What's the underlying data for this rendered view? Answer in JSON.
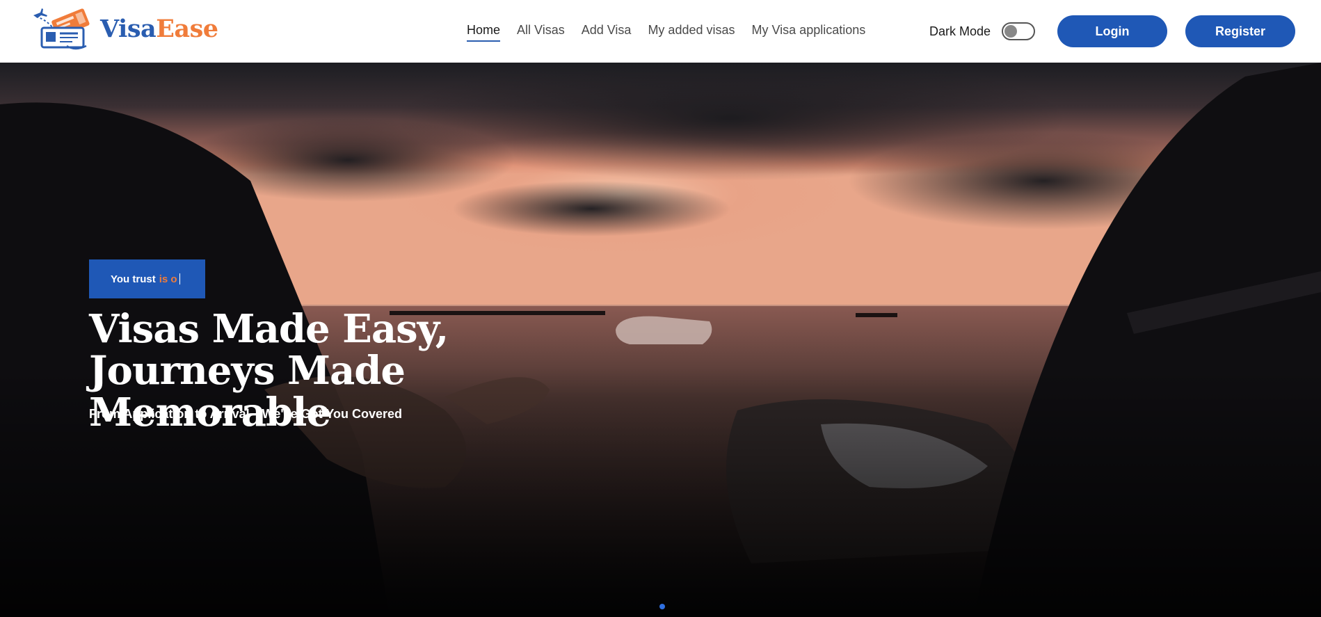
{
  "brand": {
    "name_part1": "Visa",
    "name_part2": "Ease",
    "primary_color": "#2a5db0",
    "accent_color": "#f07c3a"
  },
  "nav": {
    "items": [
      {
        "label": "Home",
        "active": true
      },
      {
        "label": "All Visas",
        "active": false
      },
      {
        "label": "Add Visa",
        "active": false
      },
      {
        "label": "My added visas",
        "active": false
      },
      {
        "label": "My Visa applications",
        "active": false
      }
    ]
  },
  "header": {
    "dark_mode_label": "Dark Mode",
    "dark_mode_on": false,
    "login_label": "Login",
    "register_label": "Register",
    "button_color": "#1f58b6"
  },
  "hero": {
    "badge_text": "You trust",
    "badge_accent_text": "is o",
    "headline": "Visas Made Easy, Journeys Made Memorable",
    "subheadline": "From Application to Arrival—We've Got You Covered",
    "slide_dots": 1,
    "background_image": "sunset-beach-photo"
  }
}
